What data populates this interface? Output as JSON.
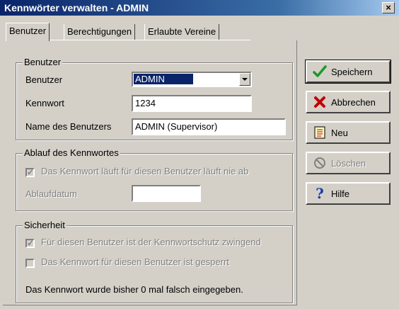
{
  "window": {
    "title": "Kennwörter verwalten - ADMIN",
    "close_glyph": "×"
  },
  "tabs": [
    {
      "label": "Benutzer",
      "active": true
    },
    {
      "label": "Berechtigungen",
      "active": false
    },
    {
      "label": "Erlaubte Vereine",
      "active": false
    }
  ],
  "benutzer_group": {
    "legend": "Benutzer",
    "user_label": "Benutzer",
    "user_value": "ADMIN",
    "password_label": "Kennwort",
    "password_value": "1234",
    "name_label": "Name des Benutzers",
    "name_value": "ADMIN (Supervisor)"
  },
  "ablauf_group": {
    "legend": "Ablauf des Kennwortes",
    "never_expires_label": "Das Kennwort läuft für diesen Benutzer läuft nie ab",
    "never_expires_checked": true,
    "expiry_label": "Ablaufdatum",
    "expiry_value": ""
  },
  "sicherheit_group": {
    "legend": "Sicherheit",
    "mandatory_label": "Für diesen Benutzer ist der Kennwortschutz zwingend",
    "mandatory_checked": true,
    "locked_label": "Das Kennwort für diesen Benutzer ist gesperrt",
    "locked_checked": false,
    "fail_text": "Das Kennwort wurde bisher 0 mal falsch eingegeben."
  },
  "buttons": {
    "save": "Speichern",
    "cancel": "Abbrechen",
    "new": "Neu",
    "delete": "Löschen",
    "help": "Hilfe"
  },
  "icons": {
    "save": "check-icon",
    "cancel": "x-icon",
    "new": "document-icon",
    "delete": "no-entry-icon",
    "help": "question-icon"
  },
  "colors": {
    "titlebar": "#0a246a",
    "face": "#d4d0c8",
    "disabled_text": "#808080",
    "accent_blue": "#1a3ea8",
    "accent_green": "#1a9a2a",
    "accent_red": "#c00000"
  }
}
